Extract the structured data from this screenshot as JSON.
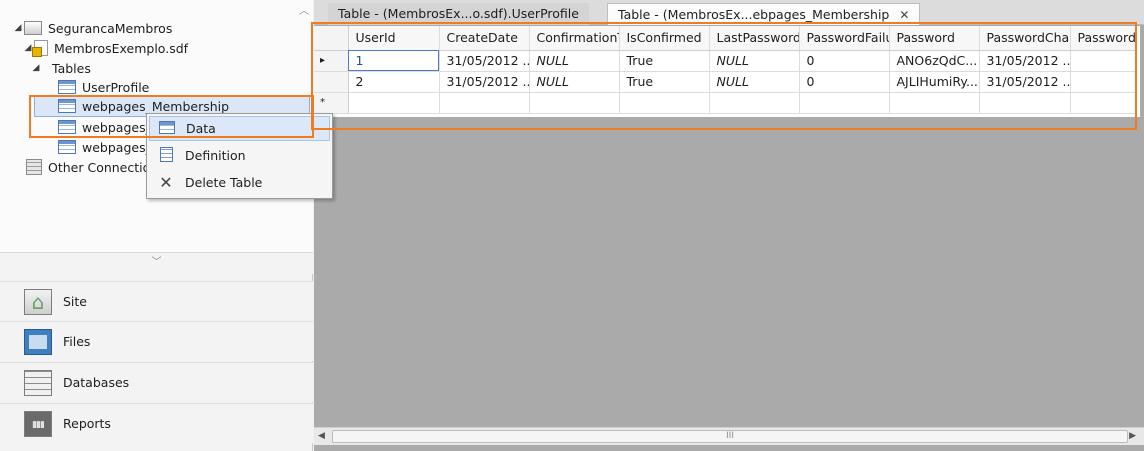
{
  "tree": {
    "root": "SegurancaMembros",
    "database": "MembrosExemplo.sdf",
    "tables_folder": "Tables",
    "tables": [
      "UserProfile",
      "webpages_Membership",
      "webpages_",
      "webpages_"
    ],
    "other_connections": "Other Connectio"
  },
  "context_menu": {
    "data": "Data",
    "definition": "Definition",
    "delete_table": "Delete Table"
  },
  "nav": {
    "site": "Site",
    "files": "Files",
    "databases": "Databases",
    "reports": "Reports"
  },
  "tabs": [
    {
      "label": "Table - (MembrosEx...o.sdf).UserProfile",
      "active": false
    },
    {
      "label": "Table - (MembrosEx...ebpages_Membership",
      "active": true
    }
  ],
  "grid": {
    "columns": [
      "UserId",
      "CreateDate",
      "ConfirmationT",
      "IsConfirmed",
      "LastPasswordI",
      "PasswordFailu",
      "Password",
      "PasswordChar",
      "PasswordS"
    ],
    "rows": [
      [
        "1",
        "31/05/2012 ...",
        "NULL",
        "True",
        "NULL",
        "0",
        "ANO6zQdC...",
        "31/05/2012 ...",
        ""
      ],
      [
        "2",
        "31/05/2012 ...",
        "NULL",
        "True",
        "NULL",
        "0",
        "AJLIHumiRy...",
        "31/05/2012 ...",
        ""
      ]
    ],
    "row_markers": [
      "▸",
      "",
      "*"
    ]
  },
  "colors": {
    "highlight": "#f07c22",
    "selection": "#dce8f7",
    "workspace": "#aaaaaa"
  },
  "scrollbar": {
    "grip": "III"
  }
}
